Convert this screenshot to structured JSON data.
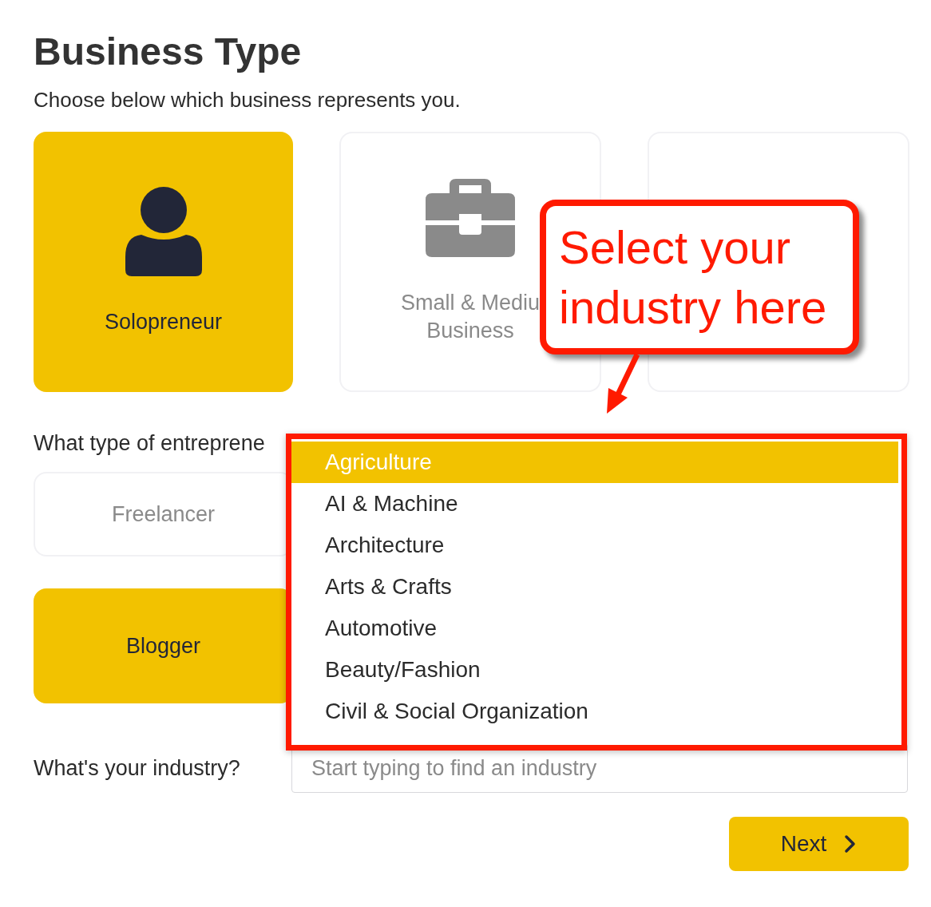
{
  "heading": "Business Type",
  "subtitle": "Choose below which business represents you.",
  "business_types": [
    {
      "kind": "person",
      "label_lines": [
        "Solopreneur"
      ],
      "selected": true
    },
    {
      "kind": "briefcase",
      "label_lines": [
        "Small & Mediu",
        "Business"
      ],
      "selected": false
    },
    {
      "kind": "hidden",
      "selected": false
    }
  ],
  "entrepreneur_question": "What type of entreprene",
  "entrepreneur_types": [
    {
      "label": "Freelancer",
      "selected": false
    },
    {
      "label": "Blogger",
      "selected": true
    }
  ],
  "industry_dropdown": {
    "options": [
      {
        "label": "Agriculture",
        "selected": true
      },
      {
        "label": "AI & Machine",
        "selected": false
      },
      {
        "label": "Architecture",
        "selected": false
      },
      {
        "label": "Arts & Crafts",
        "selected": false
      },
      {
        "label": "Automotive",
        "selected": false
      },
      {
        "label": "Beauty/Fashion",
        "selected": false
      },
      {
        "label": "Civil & Social Organization",
        "selected": false
      }
    ]
  },
  "industry_question": "What's your industry?",
  "industry_field": {
    "placeholder": "Start typing to find an industry"
  },
  "next_button": {
    "label": "Next"
  },
  "callout": {
    "lines": [
      "Select your",
      "industry here"
    ]
  }
}
